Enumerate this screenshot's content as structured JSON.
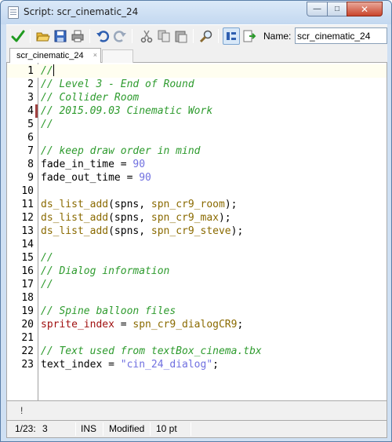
{
  "window": {
    "title": "Script: scr_cinematic_24",
    "controls": {
      "minimize": "—",
      "maximize": "□",
      "close": "✕"
    }
  },
  "toolbar": {
    "buttons": [
      {
        "name": "ok-icon"
      },
      {
        "name": "open-icon"
      },
      {
        "name": "save-icon"
      },
      {
        "name": "print-icon"
      },
      {
        "name": "undo-icon"
      },
      {
        "name": "redo-icon"
      },
      {
        "name": "cut-icon"
      },
      {
        "name": "copy-icon"
      },
      {
        "name": "paste-icon"
      },
      {
        "name": "search-icon"
      },
      {
        "name": "toggle-code-icon"
      },
      {
        "name": "insert-file-icon"
      }
    ],
    "name_label": "Name:",
    "name_value": "scr_cinematic_24"
  },
  "tabs": [
    {
      "label": "scr_cinematic_24",
      "close": "×"
    }
  ],
  "editor": {
    "lines": [
      {
        "n": "1",
        "tokens": [
          {
            "t": "//",
            "c": "comment"
          }
        ]
      },
      {
        "n": "2",
        "tokens": [
          {
            "t": "// Level 3 - End of Round",
            "c": "comment"
          }
        ]
      },
      {
        "n": "3",
        "tokens": [
          {
            "t": "// Collider Room",
            "c": "comment"
          }
        ]
      },
      {
        "n": "4",
        "tokens": [
          {
            "t": "// 2015.09.03 Cinematic Work",
            "c": "comment"
          }
        ]
      },
      {
        "n": "5",
        "tokens": [
          {
            "t": "//",
            "c": "comment"
          }
        ]
      },
      {
        "n": "6",
        "tokens": []
      },
      {
        "n": "7",
        "tokens": [
          {
            "t": "// keep draw order in mind",
            "c": "comment"
          }
        ]
      },
      {
        "n": "8",
        "tokens": [
          {
            "t": "fade_in_time = ",
            "c": "plain"
          },
          {
            "t": "90",
            "c": "num"
          }
        ]
      },
      {
        "n": "9",
        "tokens": [
          {
            "t": "fade_out_time = ",
            "c": "plain"
          },
          {
            "t": "90",
            "c": "num"
          }
        ]
      },
      {
        "n": "10",
        "tokens": []
      },
      {
        "n": "11",
        "tokens": [
          {
            "t": "ds_list_add",
            "c": "func"
          },
          {
            "t": "(spns, ",
            "c": "plain"
          },
          {
            "t": "spn_cr9_room",
            "c": "res"
          },
          {
            "t": ");",
            "c": "plain"
          }
        ]
      },
      {
        "n": "12",
        "tokens": [
          {
            "t": "ds_list_add",
            "c": "func"
          },
          {
            "t": "(spns, ",
            "c": "plain"
          },
          {
            "t": "spn_cr9_max",
            "c": "res"
          },
          {
            "t": ");",
            "c": "plain"
          }
        ]
      },
      {
        "n": "13",
        "tokens": [
          {
            "t": "ds_list_add",
            "c": "func"
          },
          {
            "t": "(spns, ",
            "c": "plain"
          },
          {
            "t": "spn_cr9_steve",
            "c": "res"
          },
          {
            "t": ");",
            "c": "plain"
          }
        ]
      },
      {
        "n": "14",
        "tokens": []
      },
      {
        "n": "15",
        "tokens": [
          {
            "t": "//",
            "c": "comment"
          }
        ]
      },
      {
        "n": "16",
        "tokens": [
          {
            "t": "// Dialog information",
            "c": "comment"
          }
        ]
      },
      {
        "n": "17",
        "tokens": [
          {
            "t": "//",
            "c": "comment"
          }
        ]
      },
      {
        "n": "18",
        "tokens": []
      },
      {
        "n": "19",
        "tokens": [
          {
            "t": "// Spine balloon files",
            "c": "comment"
          }
        ]
      },
      {
        "n": "20",
        "tokens": [
          {
            "t": "sprite_index",
            "c": "builtin"
          },
          {
            "t": " = ",
            "c": "plain"
          },
          {
            "t": "spn_cr9_dialogCR9",
            "c": "res"
          },
          {
            "t": ";",
            "c": "plain"
          }
        ]
      },
      {
        "n": "21",
        "tokens": []
      },
      {
        "n": "22",
        "tokens": [
          {
            "t": "// Text used from textBox_cinema.tbx",
            "c": "comment"
          }
        ]
      },
      {
        "n": "23",
        "tokens": [
          {
            "t": "text_index = ",
            "c": "plain"
          },
          {
            "t": "\"cin_24_dialog\"",
            "c": "str"
          },
          {
            "t": ";",
            "c": "plain"
          }
        ]
      }
    ]
  },
  "bottom": {
    "mark": "!"
  },
  "status": {
    "position": "1/23:",
    "column": "3",
    "mode": "INS",
    "state": "Modified",
    "font_size": "10 pt"
  },
  "colors": {
    "comment": "#2e9b2e",
    "func": "#8a6a00",
    "res": "#8a6a00",
    "num": "#7070e0",
    "str": "#7070e0",
    "builtin": "#a01010"
  }
}
